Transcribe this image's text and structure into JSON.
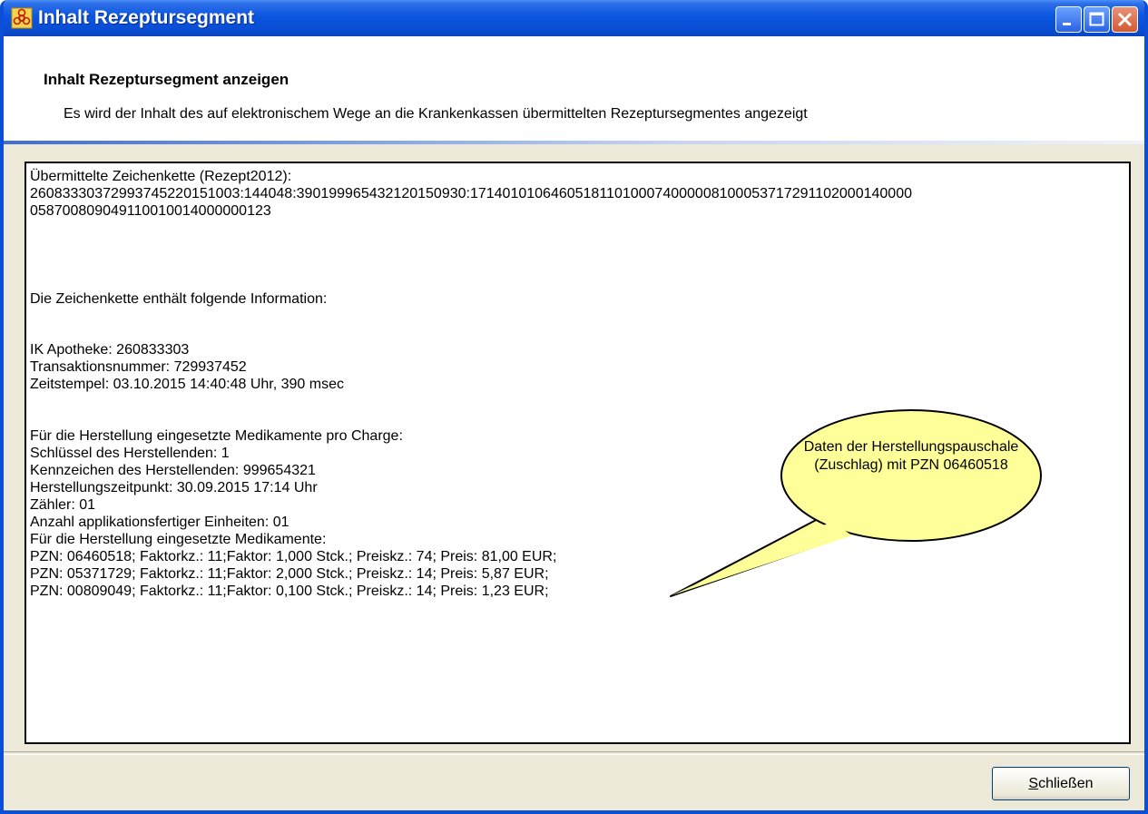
{
  "window": {
    "title": "Inhalt Rezeptursegment",
    "controls": {
      "minimize": "minimize-icon",
      "maximize": "maximize-icon",
      "close": "close-icon"
    }
  },
  "header": {
    "title": "Inhalt Rezeptursegment anzeigen",
    "description": "Es wird der Inhalt des auf elektronischem Wege an die Krankenkassen übermittelten Rezeptursegmentes angezeigt"
  },
  "content": {
    "lines": [
      "Übermittelte Zeichenkette (Rezept2012):",
      "2608333037299374522015100 3:144048:3901999654321201509 30:1714010106460518110100074000008100053717291102000140000",
      "0587008090491100100140000 00123",
      "Die Zeichenkette enthält folgende Information:",
      "IK Apotheke: 260833303",
      "Transaktionsnummer: 729937452",
      "Zeitstempel: 03.10.2015 14:40:48 Uhr, 390 msec",
      "Für die Herstellung eingesetzte Medikamente pro Charge:",
      "Schlüssel des Herstellenden: 1",
      "Kennzeichen des Herstellenden: 999654321",
      "Herstellungszeitpunkt: 30.09.2015 17:14 Uhr",
      "Zähler: 01",
      "Anzahl applikationsfertiger Einheiten: 01",
      "Für die Herstellung eingesetzte Medikamente:",
      "PZN: 06460518; Faktorkz.: 11;Faktor: 1,000 Stck.; Preiskz.: 74; Preis: 81,00 EUR;",
      "PZN: 05371729; Faktorkz.: 11;Faktor: 2,000 Stck.; Preiskz.: 14; Preis: 5,87 EUR;",
      "PZN: 00809049; Faktorkz.: 11;Faktor: 0,100 Stck.; Preiskz.: 14; Preis: 1,23 EUR;"
    ]
  },
  "callout": {
    "text": "Daten der Herstellungspauschale (Zuschlag) mit PZN 06460518"
  },
  "footer": {
    "close_label": "Schließen"
  },
  "colors": {
    "titlebar": "#0a55e0",
    "callout_fill": "#ffff99"
  }
}
